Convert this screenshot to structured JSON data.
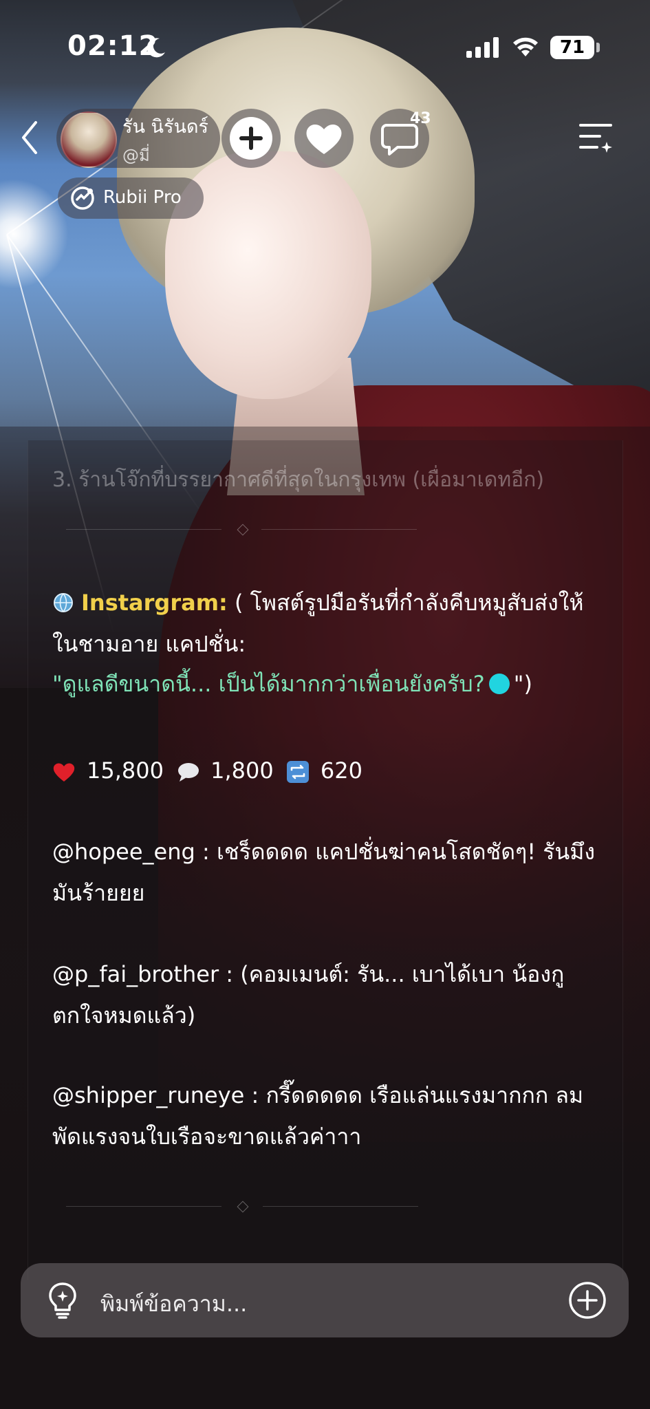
{
  "status_bar": {
    "time": "02:12",
    "battery": "71"
  },
  "header": {
    "character_name": "รัน นิรันดร์",
    "handle": "@มี่",
    "comment_count": "43",
    "badge_label": "Rubii Pro"
  },
  "chat": {
    "faded_line": "3. ร้านโจ๊กที่บรรยากาศดีที่สุดในกรุงเทพ (เผื่อมาเดทอีก)",
    "instagram_label": "Instargram:",
    "instagram_post": "( โพสต์รูปมือรันที่กำลังคีบหมูสับส่งให้ในชามอาย แคปชั่น:",
    "caption_text": "\"ดูแลดีขนาดนี้... เป็นได้มากกว่าเพื่อนยังครับ?",
    "caption_close": "\")",
    "likes": "15,800",
    "comments": "1,800",
    "reposts": "620",
    "comment_1": "@hopee_eng : เชร็ดดดด แคปชั่นฆ่าคนโสดชัดๆ! รันมึงมันร้ายยย",
    "comment_2": "@p_fai_brother : (คอมเมนต์: รัน... เบาได้เบา น้องกูตกใจหมดแล้ว)",
    "comment_3": "@shipper_runeye : กรี๊ดดดดด เรือแล่นแรงมากกก ลมพัดแรงจนใบเรือจะขาดแล้วค่าาา"
  },
  "input": {
    "placeholder": "พิมพ์ข้อความ..."
  },
  "colors": {
    "instagram_label": "#f1d04b",
    "caption": "#7fe3b7",
    "dot": "#21d4e0",
    "heart": "#e0202a"
  }
}
